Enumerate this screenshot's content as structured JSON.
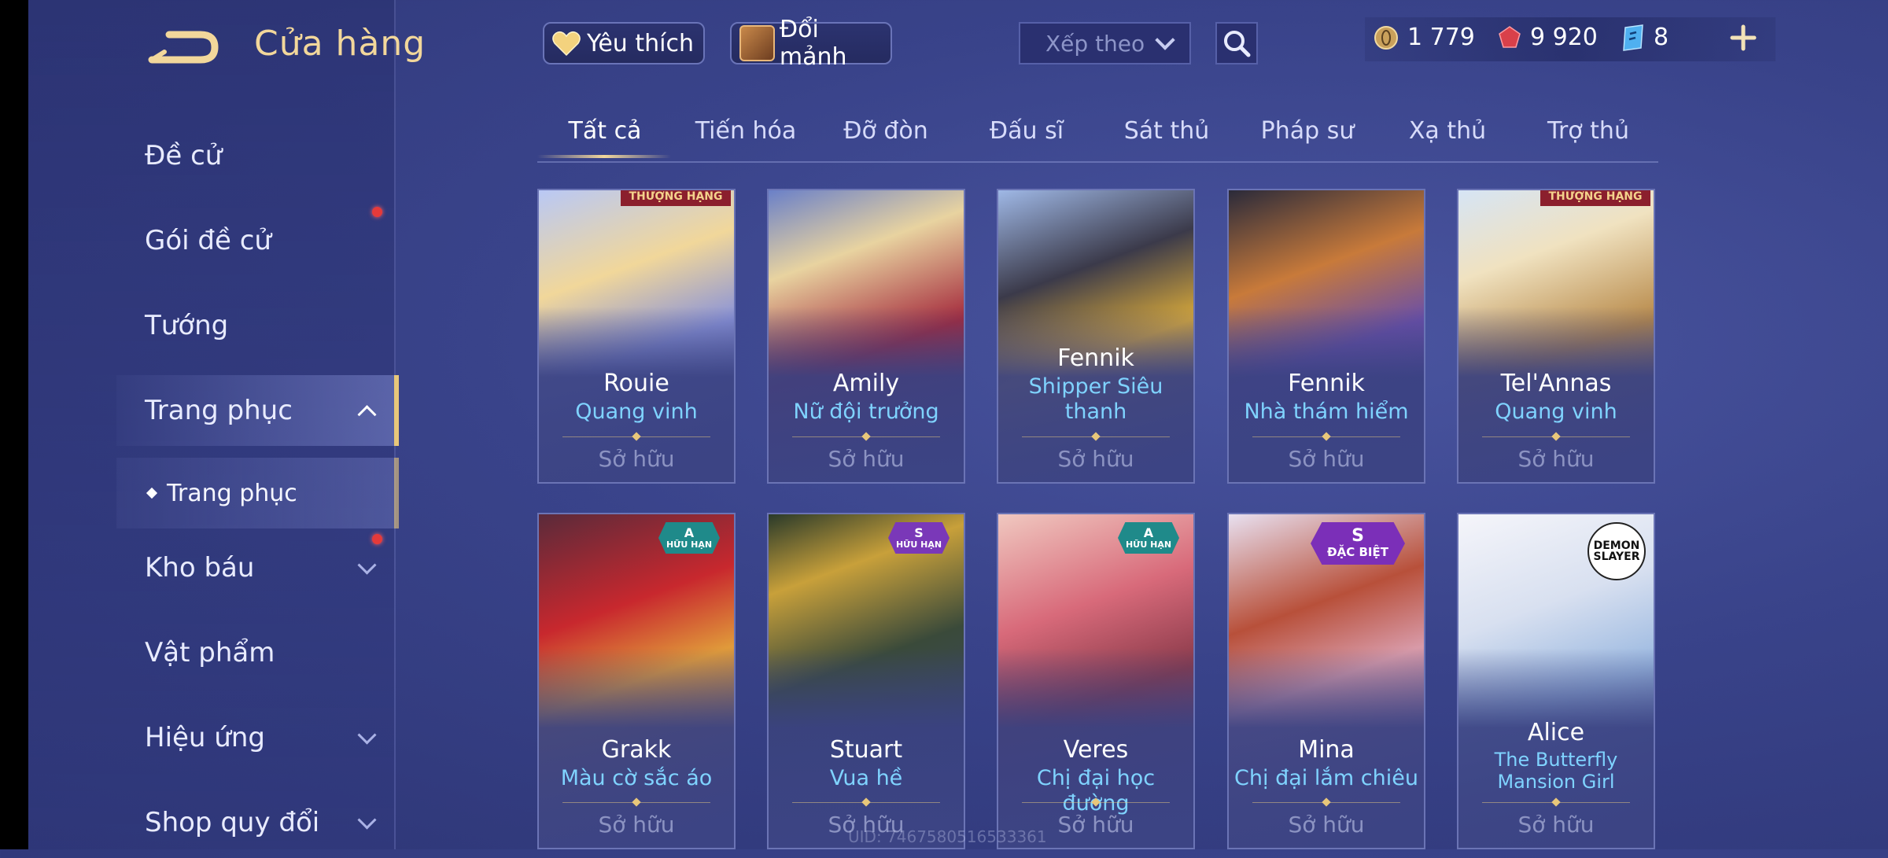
{
  "header": {
    "title": "Cửa hàng",
    "favorites_label": "Yêu thích",
    "exchange_label": "Đổi mảnh",
    "sort_placeholder": "Xếp theo"
  },
  "currencies": {
    "gold": "1 779",
    "gems": "9 920",
    "vouchers": "8"
  },
  "sidebar": {
    "items": [
      {
        "label": "Đề cử"
      },
      {
        "label": "Gói đề cử"
      },
      {
        "label": "Tướng"
      },
      {
        "label": "Trang phục"
      },
      {
        "label": "Kho báu"
      },
      {
        "label": "Vật phẩm"
      },
      {
        "label": "Hiệu ứng"
      },
      {
        "label": "Shop quy đổi"
      }
    ],
    "subitem": "Trang phục"
  },
  "tabs": [
    "Tất cả",
    "Tiến hóa",
    "Đỡ đòn",
    "Đấu sĩ",
    "Sát thủ",
    "Pháp sư",
    "Xạ thủ",
    "Trợ thủ"
  ],
  "cards": [
    {
      "hero": "Rouie",
      "skin": "Quang vinh",
      "status": "Sở hữu",
      "ribbon": "THƯỢNG HẠNG"
    },
    {
      "hero": "Amily",
      "skin": "Nữ đội trưởng",
      "status": "Sở hữu"
    },
    {
      "hero": "Fennik",
      "skin": "Shipper Siêu thanh",
      "status": "Sở hữu"
    },
    {
      "hero": "Fennik",
      "skin": "Nhà thám hiểm",
      "status": "Sở hữu"
    },
    {
      "hero": "Tel'Annas",
      "skin": "Quang vinh",
      "status": "Sở hữu",
      "ribbon": "THƯỢNG HẠNG"
    },
    {
      "hero": "Grakk",
      "skin": "Màu cờ sắc áo",
      "status": "Sở hữu",
      "badge_tier": "A",
      "badge_text": "HỮU HẠN"
    },
    {
      "hero": "Stuart",
      "skin": "Vua hề",
      "status": "Sở hữu",
      "badge_tier": "S",
      "badge_text": "HỮU HẠN"
    },
    {
      "hero": "Veres",
      "skin": "Chị đại học đường",
      "status": "Sở hữu",
      "badge_tier": "A",
      "badge_text": "HỮU HẠN"
    },
    {
      "hero": "Mina",
      "skin": "Chị đại lắm chiêu",
      "status": "Sở hữu",
      "badge_tier": "S",
      "badge_text": "ĐẶC BIỆT"
    },
    {
      "hero": "Alice",
      "skin": "The Butterfly Mansion Girl",
      "status": "Sở hữu",
      "collab_logo": "DEMON SLAYER"
    }
  ],
  "footer": {
    "uid": "UID: 7467580516533361"
  }
}
